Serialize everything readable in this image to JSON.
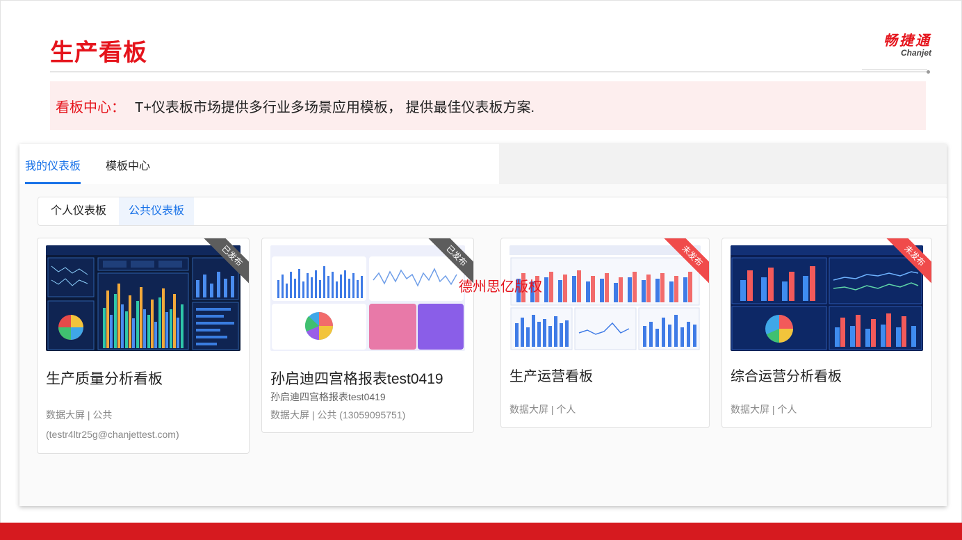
{
  "slide": {
    "title": "生产看板",
    "logo_cn": "畅捷通",
    "logo_en": "Chanjet",
    "banner_key": "看板中心：",
    "banner_text": "T+仪表板市场提供多行业多场景应用模板， 提供最佳仪表板方案.",
    "watermark": "德州思亿版权",
    "accent_color": "#e5141c"
  },
  "app": {
    "tabs": [
      {
        "label": "我的仪表板",
        "active": true
      },
      {
        "label": "模板中心",
        "active": false
      }
    ],
    "subtabs": [
      {
        "label": "个人仪表板",
        "active": false
      },
      {
        "label": "公共仪表板",
        "active": true
      }
    ],
    "cards": [
      {
        "title": "生产质量分析看板",
        "subtitle": "",
        "meta": "数据大屏 | 公共",
        "meta2": "(testr4ltr25g@chanjettest.com)",
        "status": "已发布"
      },
      {
        "title": "孙启迪四宫格报表test0419",
        "subtitle": "孙启迪四宫格报表test0419",
        "meta": "数据大屏 | 公共 (13059095751)",
        "meta2": "",
        "status": "已发布"
      },
      {
        "title": "生产运营看板",
        "subtitle": "",
        "meta": "数据大屏 | 个人",
        "meta2": "",
        "status": "未发布"
      },
      {
        "title": "综合运营分析看板",
        "subtitle": "",
        "meta": "数据大屏 | 个人",
        "meta2": "",
        "status": "未发布"
      }
    ],
    "link_color": "#1a73e8"
  }
}
